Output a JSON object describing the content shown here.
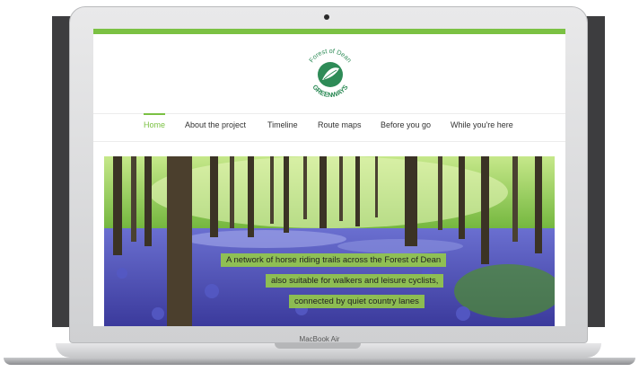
{
  "device": {
    "model_label": "MacBook Air"
  },
  "logo": {
    "top_text": "Forest of Dean",
    "bottom_text": "GREENWAYS",
    "brand_color": "#2e8b57"
  },
  "nav": {
    "items": [
      {
        "label": "Home",
        "active": true
      },
      {
        "label": "About the project",
        "active": false
      },
      {
        "label": "Timeline",
        "active": false
      },
      {
        "label": "Route maps",
        "active": false
      },
      {
        "label": "Before you go",
        "active": false
      },
      {
        "label": "While you're here",
        "active": false
      }
    ]
  },
  "hero": {
    "caption_lines": [
      "A network of horse riding trails across the Forest of Dean",
      "also suitable for walkers and leisure cyclists,",
      "connected by quiet country lanes"
    ]
  },
  "colors": {
    "accent": "#7bc143",
    "backdrop": "#3d3d3f"
  }
}
